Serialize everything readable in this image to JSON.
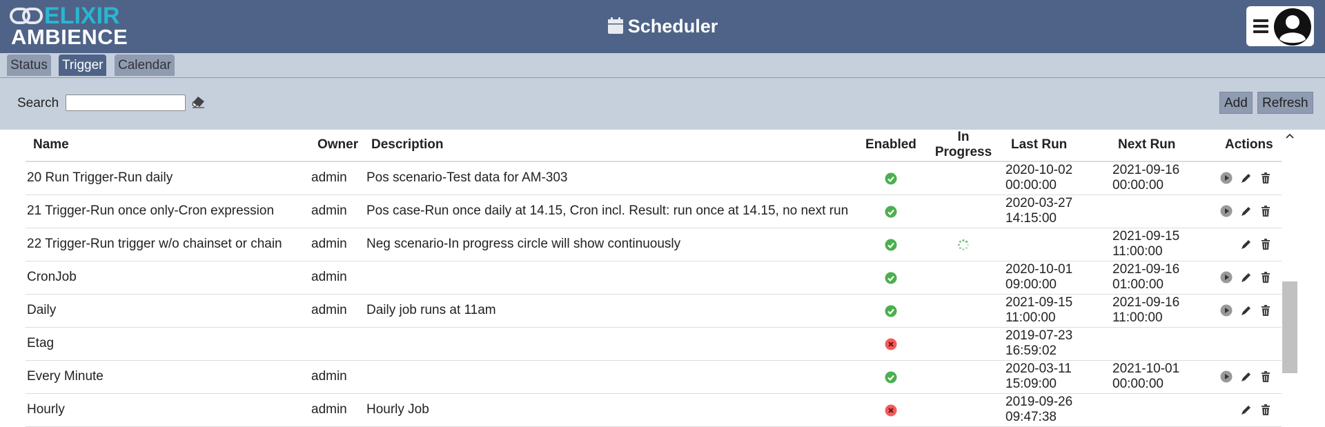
{
  "app": {
    "logo_top": "ELIXIR",
    "logo_bottom": "AMBIENCE",
    "title": "Scheduler"
  },
  "tabs": [
    {
      "label": "Status",
      "active": false
    },
    {
      "label": "Trigger",
      "active": true
    },
    {
      "label": "Calendar",
      "active": false
    }
  ],
  "toolbar": {
    "search_label": "Search",
    "search_value": "",
    "add_label": "Add",
    "refresh_label": "Refresh"
  },
  "table": {
    "headers": {
      "name": "Name",
      "owner": "Owner",
      "description": "Description",
      "enabled": "Enabled",
      "in_progress_1": "In",
      "in_progress_2": "Progress",
      "last_run": "Last Run",
      "next_run": "Next Run",
      "actions": "Actions"
    },
    "rows": [
      {
        "name": "20 Run Trigger-Run daily",
        "owner": "admin",
        "description": "Pos scenario-Test data for AM-303",
        "enabled": true,
        "in_progress": false,
        "last_run_date": "2020-10-02",
        "last_run_time": "00:00:00",
        "next_run_date": "2021-09-16",
        "next_run_time": "00:00:00",
        "actions": [
          "run",
          "edit",
          "delete"
        ]
      },
      {
        "name": "21 Trigger-Run once only-Cron expression",
        "owner": "admin",
        "description": "Pos case-Run once daily at 14.15, Cron incl. Result: run once at 14.15, no next run",
        "enabled": true,
        "in_progress": false,
        "last_run_date": "2020-03-27",
        "last_run_time": "14:15:00",
        "next_run_date": "",
        "next_run_time": "",
        "actions": [
          "run",
          "edit",
          "delete"
        ]
      },
      {
        "name": "22 Trigger-Run trigger w/o chainset or chain",
        "owner": "admin",
        "description": "Neg scenario-In progress circle will show continuously",
        "enabled": true,
        "in_progress": true,
        "last_run_date": "",
        "last_run_time": "",
        "next_run_date": "2021-09-15",
        "next_run_time": "11:00:00",
        "actions": [
          "edit",
          "delete"
        ]
      },
      {
        "name": "CronJob",
        "owner": "admin",
        "description": "",
        "enabled": true,
        "in_progress": false,
        "last_run_date": "2020-10-01",
        "last_run_time": "09:00:00",
        "next_run_date": "2021-09-16",
        "next_run_time": "01:00:00",
        "actions": [
          "run",
          "edit",
          "delete"
        ]
      },
      {
        "name": "Daily",
        "owner": "admin",
        "description": "Daily job runs at 11am",
        "enabled": true,
        "in_progress": false,
        "last_run_date": "2021-09-15",
        "last_run_time": "11:00:00",
        "next_run_date": "2021-09-16",
        "next_run_time": "11:00:00",
        "actions": [
          "run",
          "edit",
          "delete"
        ]
      },
      {
        "name": "Etag",
        "owner": "",
        "description": "",
        "enabled": false,
        "in_progress": false,
        "last_run_date": "2019-07-23",
        "last_run_time": "16:59:02",
        "next_run_date": "",
        "next_run_time": "",
        "actions": []
      },
      {
        "name": "Every Minute",
        "owner": "admin",
        "description": "",
        "enabled": true,
        "in_progress": false,
        "last_run_date": "2020-03-11",
        "last_run_time": "15:09:00",
        "next_run_date": "2021-10-01",
        "next_run_time": "00:00:00",
        "actions": [
          "run",
          "edit",
          "delete"
        ]
      },
      {
        "name": "Hourly",
        "owner": "admin",
        "description": "Hourly Job",
        "enabled": false,
        "in_progress": false,
        "last_run_date": "2019-09-26",
        "last_run_time": "09:47:38",
        "next_run_date": "",
        "next_run_time": "",
        "actions": [
          "edit",
          "delete"
        ]
      }
    ]
  },
  "icons": {
    "enabled_true": "check-circle-icon",
    "enabled_false": "x-circle-icon",
    "in_progress": "spinner-icon",
    "run": "play-circle-icon",
    "edit": "pencil-icon",
    "delete": "trash-icon"
  },
  "colors": {
    "header_bg": "#4e6387",
    "logo_accent": "#29b6d2",
    "toolbar_bg": "#c6d0dc",
    "tab_bg": "#8e9bb1",
    "enabled_green": "#4caf50",
    "disabled_red": "#f25c5c"
  }
}
